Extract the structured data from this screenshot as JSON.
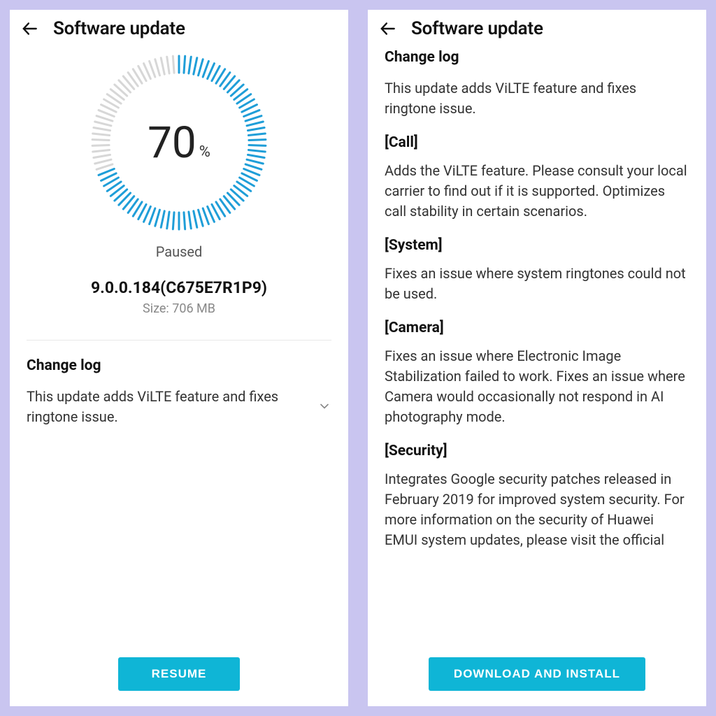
{
  "left": {
    "title": "Software update",
    "progress_percent": 70,
    "progress_status": "Paused",
    "version": "9.0.0.184(C675E7R1P9)",
    "size_label": "Size: 706 MB",
    "changelog_heading": "Change log",
    "summary": "This update adds ViLTE feature and fixes ringtone issue.",
    "button": "RESUME"
  },
  "right": {
    "title": "Software update",
    "changelog_heading": "Change log",
    "summary": "This update adds ViLTE feature and fixes ringtone issue.",
    "sections": {
      "call": {
        "heading": "[Call]",
        "body": "Adds the ViLTE feature. Please consult your local carrier to find out if it is supported.\nOptimizes call stability in certain scenarios."
      },
      "system": {
        "heading": "[System]",
        "body": "Fixes an issue where system ringtones could not be used."
      },
      "camera": {
        "heading": "[Camera]",
        "body": "Fixes an issue where Electronic Image Stabilization failed to work.\nFixes an issue where Camera would occasionally not respond in AI photography mode."
      },
      "security": {
        "heading": "[Security]",
        "body": "Integrates Google security patches released in February 2019 for improved system security.\nFor more information on the security of Huawei EMUI system updates, please visit the official"
      }
    },
    "button": "DOWNLOAD AND INSTALL"
  },
  "colors": {
    "accent": "#0fb5d6",
    "ring_active": "#1f9ed8",
    "ring_inactive": "#d7d7d7"
  }
}
